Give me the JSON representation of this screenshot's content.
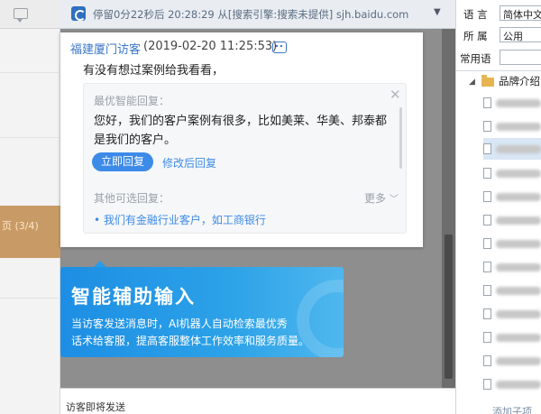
{
  "header": {
    "status_text": "停留0分22秒后 20:28:29  从[搜索引擎:搜索未提供] sjh.baidu.com"
  },
  "left_panel": {
    "selected_item_text": "页 (3/4)"
  },
  "footer": {
    "label": "访客即将发送"
  },
  "right_panel": {
    "language_label": "语 言",
    "language_value": "简体中文",
    "belong_label": "所 属",
    "belong_value": "公用",
    "common_phrases_label": "常用语",
    "tree_title": "品牌介绍",
    "bottom_link": "添加子项"
  },
  "popup": {
    "visitor_name": "福建厦门访客",
    "timestamp": "(2019-02-20 11:25:53)",
    "visitor_message": "有没有想过案例给我看看，",
    "best_reply_label": "最优智能回复：",
    "best_reply_text": "您好，我们的客户案例有很多，比如美莱、华美、邦泰都是我们的客户。",
    "reply_now_button": "立即回复",
    "edit_reply_link": "修改后回复",
    "other_replies_label": "其他可选回复：",
    "more_label": "更多",
    "suggestion": "• 我们有金融行业客户，如工商银行"
  },
  "tip": {
    "title": "智能辅助输入",
    "line1": "当访客发送消息时，AI机器人自动检索最优秀",
    "line2": "话术给客服，提高客服整体工作效率和服务质量。"
  },
  "colors": {
    "accent_blue": "#3d8be8",
    "tip_gradient_start": "#1d8ee4",
    "visitor_name": "#3b76c9",
    "overlay_gray": "#8e8e8e",
    "selected_brown": "#c89b66"
  }
}
